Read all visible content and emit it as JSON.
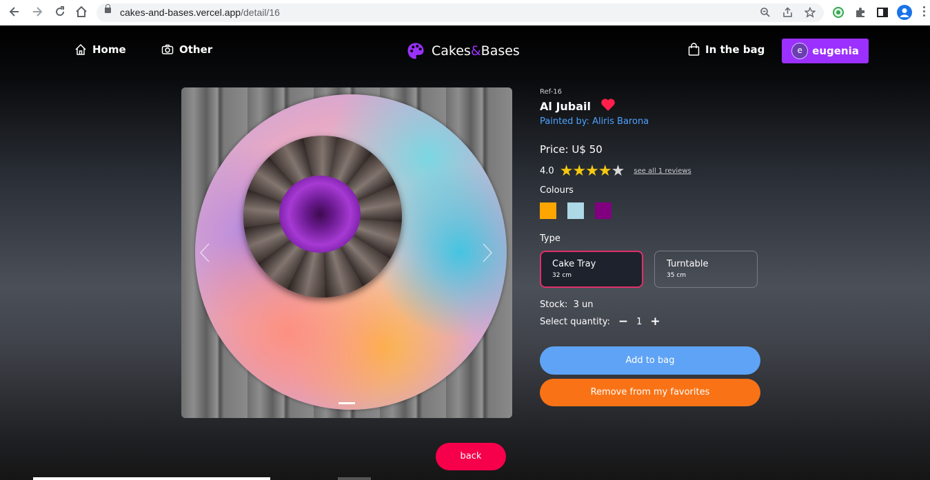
{
  "browser": {
    "url_host": "cakes-and-bases.vercel.app",
    "url_path": "/detail/16"
  },
  "nav": {
    "home_label": "Home",
    "other_label": "Other",
    "brand_part1": "Cakes",
    "brand_amp": "&",
    "brand_part2": "Bases",
    "bag_label": "In the bag",
    "user_initial": "e",
    "user_name": "eugenia"
  },
  "product": {
    "ref": "Ref-16",
    "title": "Al Jubail",
    "painter": "Painted by: Aliris Barona",
    "price": "Price: U$ 50",
    "rating_value": "4.0",
    "rating": 4,
    "rating_max": 5,
    "reviews_link": "see all 1 reviews",
    "colours_label": "Colours",
    "colours": [
      "#FFA500",
      "#ADD8E6",
      "#800080"
    ],
    "type_label": "Type",
    "types": [
      {
        "name": "Cake Tray",
        "size": "32 cm",
        "selected": true
      },
      {
        "name": "Turntable",
        "size": "35 cm",
        "selected": false
      }
    ],
    "stock_label": "Stock:",
    "stock_value": "3 un",
    "quantity_label": "Select quantity:",
    "quantity_minus": "−",
    "quantity_value": "1",
    "quantity_plus": "+",
    "add_label": "Add to bag",
    "remove_fav_label": "Remove from my favorites",
    "back_label": "back"
  },
  "colors": {
    "accent_purple": "#9b30ff",
    "add_blue": "#5ea3f5",
    "remove_orange": "#f97316",
    "back_red": "#f7004b",
    "heart_red": "#ff1f4b",
    "star_gold": "#f6c90e"
  },
  "icons": [
    "back-arrow-icon",
    "forward-arrow-icon",
    "reload-icon",
    "home-icon",
    "lock-icon",
    "zoom-icon",
    "share-icon",
    "bookmark-star-icon",
    "extension-icon",
    "puzzle-icon",
    "sidebar-icon",
    "profile-icon",
    "menu-icon",
    "house-icon",
    "camera-icon",
    "palette-icon",
    "bag-icon",
    "heart-icon",
    "star-icon",
    "chevron-left-icon",
    "chevron-right-icon"
  ]
}
